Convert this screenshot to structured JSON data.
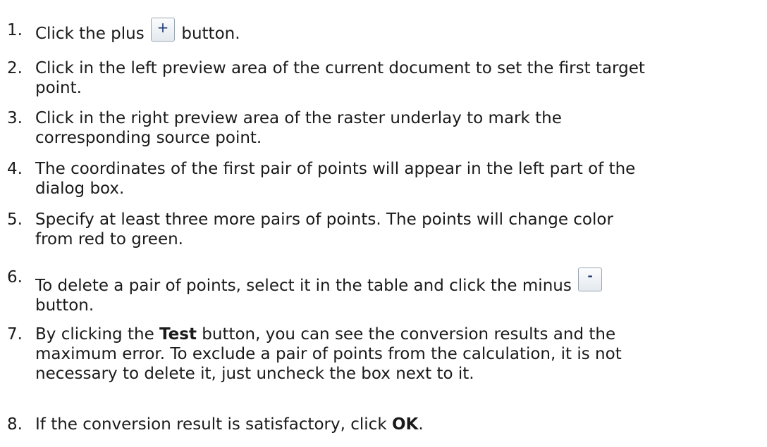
{
  "steps": [
    {
      "number": "1.",
      "before": "Click the plus",
      "icon": "plus-icon",
      "icon_glyph": "+",
      "after": "button."
    },
    {
      "number": "2.",
      "line1": "Click in the left preview area of the current document to set the first target",
      "line2": "point."
    },
    {
      "number": "3.",
      "line1": "Click in the right preview area of the raster underlay to mark the",
      "line2": "corresponding source point."
    },
    {
      "number": "4.",
      "line1": "The coordinates of the first pair of points will appear in the left part of the",
      "line2": "dialog box."
    },
    {
      "number": "5.",
      "line1": "Specify at least three more pairs of points. The points will change color",
      "line2": "from red to green."
    },
    {
      "number": "6.",
      "before": "To delete a pair of points, select it in the table and click the minus",
      "icon": "minus-icon",
      "icon_glyph": "-",
      "after": "button."
    },
    {
      "number": "7.",
      "pre_bold": "By clicking the",
      "bold": "Test",
      "post_bold": "button, you can see the conversion results and the",
      "line2": "maximum error. To exclude a pair of points from the calculation, it is not",
      "line3": "necessary to delete it, just uncheck the box next to it."
    },
    {
      "number": "8.",
      "pre_bold": "If the conversion result is satisfactory, click",
      "bold": "OK",
      "post_bold": "."
    }
  ]
}
